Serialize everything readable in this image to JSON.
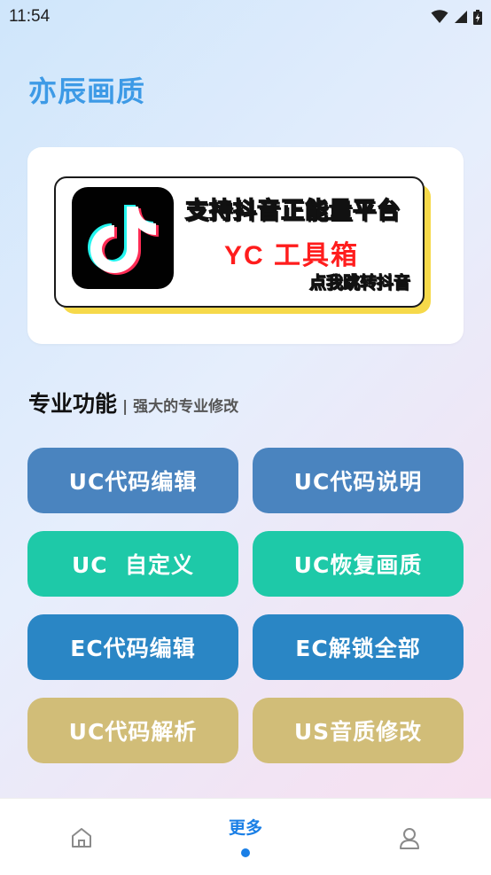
{
  "status_bar": {
    "time": "11:54",
    "icons": [
      "wifi-icon",
      "cell-signal-icon",
      "battery-charging-icon"
    ]
  },
  "app": {
    "title": "亦辰画质"
  },
  "banner": {
    "logo_icon": "tiktok-logo-icon",
    "line1": "支持抖音正能量平台",
    "line2": "YC 工具箱",
    "line3": "点我跳转抖音"
  },
  "section": {
    "title": "专业功能",
    "subtitle": "| 强大的专业修改"
  },
  "buttons": [
    {
      "label": "UC代码编辑",
      "color": "#4a84bf"
    },
    {
      "label": "UC代码说明",
      "color": "#4a84bf"
    },
    {
      "label": "UC  自定义",
      "color": "#1ec9a8"
    },
    {
      "label": "UC恢复画质",
      "color": "#1ec9a8"
    },
    {
      "label": "EC代码编辑",
      "color": "#2a86c5"
    },
    {
      "label": "EC解锁全部",
      "color": "#2a86c5"
    },
    {
      "label": "UC代码解析",
      "color": "#d1bd78"
    },
    {
      "label": "US音质修改",
      "color": "#d1bd78"
    }
  ],
  "tab_bar": {
    "tabs": [
      {
        "icon": "home-icon",
        "label": ""
      },
      {
        "icon": "",
        "label": "更多",
        "active": true
      },
      {
        "icon": "user-icon",
        "label": ""
      }
    ],
    "accent": "#1a7fe6"
  }
}
